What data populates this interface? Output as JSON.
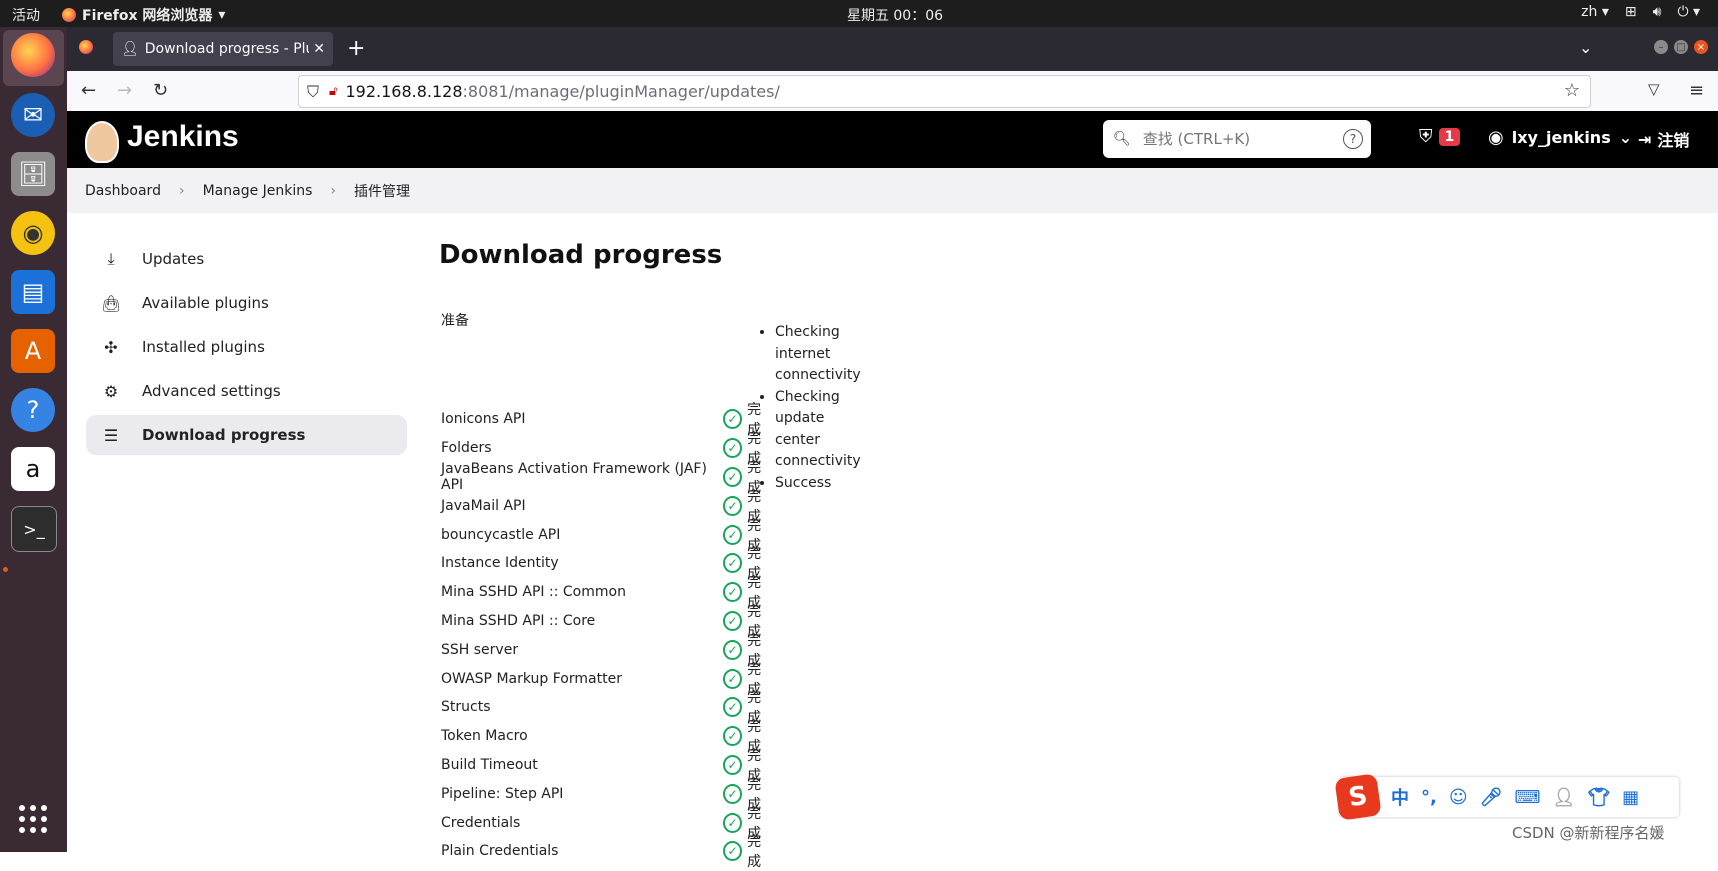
{
  "os": {
    "activities": "活动",
    "app_name": "Firefox 网络浏览器",
    "clock": "星期五 00：06",
    "lang": "zh"
  },
  "browser": {
    "tab_title": "Download progress - Plu",
    "url_host": "192.168.8.128",
    "url_path": ":8081/manage/pluginManager/updates/"
  },
  "jenkins": {
    "brand": "Jenkins",
    "search_placeholder": "查找 (CTRL+K)",
    "alert_count": "1",
    "user": "lxy_jenkins",
    "logout": "注销"
  },
  "breadcrumb": [
    "Dashboard",
    "Manage Jenkins",
    "插件管理"
  ],
  "sidebar": {
    "items": [
      {
        "label": "Updates",
        "icon": "download-icon"
      },
      {
        "label": "Available plugins",
        "icon": "shopping-bag-icon"
      },
      {
        "label": "Installed plugins",
        "icon": "puzzle-icon"
      },
      {
        "label": "Advanced settings",
        "icon": "gear-icon"
      },
      {
        "label": "Download progress",
        "icon": "list-icon"
      }
    ]
  },
  "main": {
    "title": "Download progress",
    "prepare_label": "准备",
    "prepare_steps": [
      "Checking internet connectivity",
      "Checking update center connectivity",
      "Success"
    ],
    "status_done": "完成",
    "plugins": [
      "Ionicons API",
      "Folders",
      "JavaBeans Activation Framework (JAF) API",
      "JavaMail API",
      "bouncycastle API",
      "Instance Identity",
      "Mina SSHD API :: Common",
      "Mina SSHD API :: Core",
      "SSH server",
      "OWASP Markup Formatter",
      "Structs",
      "Token Macro",
      "Build Timeout",
      "Pipeline: Step API",
      "Credentials",
      "Plain Credentials"
    ]
  },
  "ime": {
    "mode": "中",
    "punct": "°,"
  },
  "watermark": "CSDN @新新程序名媛",
  "colors": {
    "success": "#18a558",
    "header_bg": "#000000",
    "alert_badge": "#e63946"
  }
}
